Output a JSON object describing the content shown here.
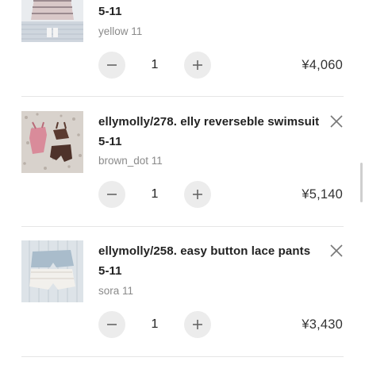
{
  "cart": {
    "items": [
      {
        "title_line1": "",
        "title_line2": "5-11",
        "variant": "yellow 11",
        "quantity": "1",
        "price": "¥4,060",
        "image_icon": "striped-dress-thumbnail"
      },
      {
        "title_line1": "ellymolly/278. elly reverseble swimsuit",
        "title_line2": "5-11",
        "variant": "brown_dot 11",
        "quantity": "1",
        "price": "¥5,140",
        "image_icon": "swimsuit-thumbnail"
      },
      {
        "title_line1": "ellymolly/258. easy button lace pants",
        "title_line2": "5-11",
        "variant": "sora 11",
        "quantity": "1",
        "price": "¥3,430",
        "image_icon": "lace-pants-thumbnail"
      }
    ]
  },
  "icons": {
    "minus": "minus-icon",
    "plus": "plus-icon",
    "remove": "close-icon"
  }
}
